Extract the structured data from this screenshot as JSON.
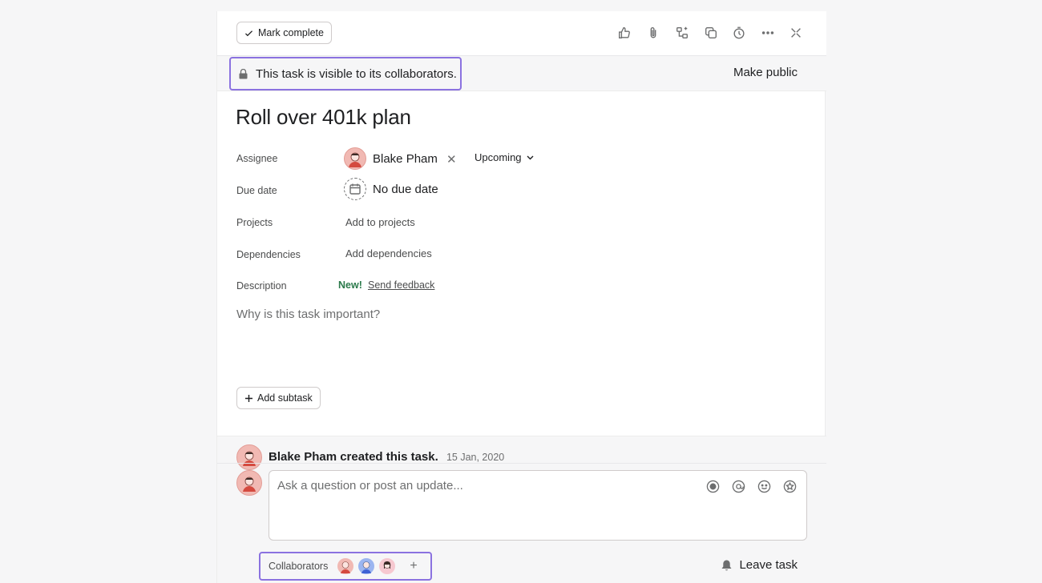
{
  "toolbar": {
    "mark_complete_label": "Mark complete"
  },
  "privacy": {
    "notice": "This task is visible to its collaborators.",
    "make_public_label": "Make public"
  },
  "task": {
    "title": "Roll over 401k plan",
    "fields": {
      "assignee_label": "Assignee",
      "assignee_name": "Blake Pham",
      "section": "Upcoming",
      "due_date_label": "Due date",
      "due_date_value": "No due date",
      "projects_label": "Projects",
      "projects_action": "Add to projects",
      "dependencies_label": "Dependencies",
      "dependencies_action": "Add dependencies",
      "description_label": "Description",
      "new_badge": "New!",
      "send_feedback": "Send feedback",
      "description_placeholder": "Why is this task important?"
    },
    "add_subtask_label": "Add subtask"
  },
  "activity": {
    "author": "Blake Pham",
    "action": "created this task.",
    "date": "15 Jan, 2020"
  },
  "composer": {
    "placeholder": "Ask a question or post an update..."
  },
  "footer": {
    "collaborators_label": "Collaborators",
    "leave_task_label": "Leave task"
  },
  "colors": {
    "accent_outline": "#8b72e0",
    "new_badge": "#2b7a4b",
    "avatar": "#f1b9b3"
  }
}
